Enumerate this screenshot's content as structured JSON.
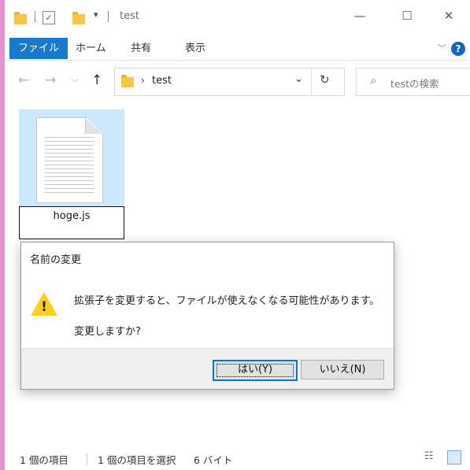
{
  "window": {
    "title": "test"
  },
  "window_controls": {
    "minimize": "—",
    "maximize": "☐",
    "close": "✕"
  },
  "ribbon": {
    "tabs": [
      "ファイル",
      "ホーム",
      "共有",
      "表示"
    ],
    "help": "?"
  },
  "address": {
    "path_segment": "test"
  },
  "search": {
    "placeholder": "testの検索"
  },
  "file": {
    "name": "hoge.js"
  },
  "dialog": {
    "title": "名前の変更",
    "message": "拡張子を変更すると、ファイルが使えなくなる可能性があります。",
    "question": "変更しますか?",
    "yes_label": "はい(Y)",
    "no_label": "いいえ(N)"
  },
  "status": {
    "item_count": "1 個の項目",
    "selected": "1 個の項目を選択",
    "size": "6 バイト"
  }
}
